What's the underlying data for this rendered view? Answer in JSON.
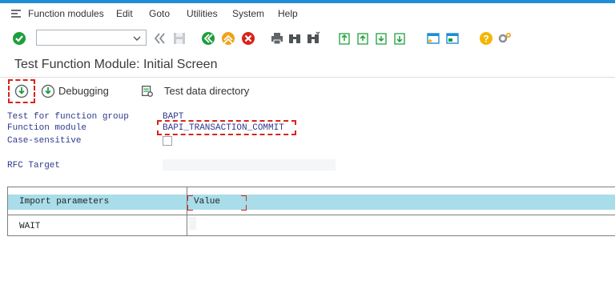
{
  "menu": {
    "items": [
      {
        "label": "Function modules"
      },
      {
        "label": "Edit"
      },
      {
        "label": "Goto"
      },
      {
        "label": "Utilities"
      },
      {
        "label": "System"
      },
      {
        "label": "Help"
      }
    ]
  },
  "toolbar": {
    "command_field_value": "",
    "icons": [
      "enter-check-icon",
      "back-icon",
      "save-icon",
      "green-back-icon",
      "exit-icon",
      "cancel-icon",
      "print-icon",
      "find-icon",
      "find-next-icon",
      "first-page-icon",
      "previous-page-icon",
      "next-page-icon",
      "last-page-icon",
      "create-session-icon",
      "shortcut-icon",
      "help-icon",
      "settings-icon"
    ],
    "colors": {
      "green": "#1e9e3a",
      "orange": "#f0a21a",
      "red": "#d9231c",
      "yellow": "#f2b705",
      "gray": "#8a8f94",
      "blue_accent": "#1f8dd6"
    }
  },
  "page": {
    "title": "Test Function Module: Initial Screen"
  },
  "app_toolbar": {
    "execute_icon": "execute-icon",
    "debugging_label": "Debugging",
    "test_data_label": "Test data directory"
  },
  "form": {
    "group_label": "Test for function group",
    "group_value": "BAPT",
    "module_label": "Function module",
    "module_value": "BAPI_TRANSACTION_COMMIT",
    "case_label": "Case-sensitive",
    "case_checked": false,
    "rfc_label": "RFC Target",
    "rfc_value": ""
  },
  "table": {
    "headers": [
      "Import parameters",
      "Value"
    ],
    "rows": [
      {
        "param": "WAIT",
        "value": ""
      }
    ]
  }
}
